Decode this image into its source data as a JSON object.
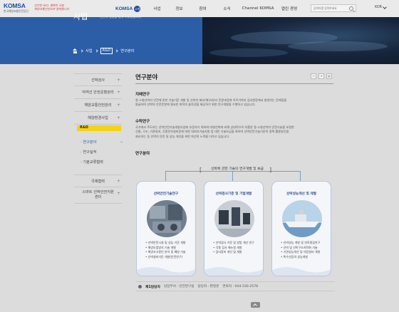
{
  "header": {
    "logo_text": "KOMSA",
    "logo_sub": "한국해양교통안전공단",
    "slogan_line1": "안전한 바다, 행복한 국민",
    "slogan_line2": "해양교통안전으로 함께합니다",
    "home_label": "KOMSA",
    "home_badge": "소개",
    "menu": [
      "사업",
      "정보",
      "참여",
      "소식",
      "Channel KOMSA",
      "열린 경영"
    ],
    "search_placeholder": "검색어를 입력하세요",
    "lang": "KOR"
  },
  "banner": {
    "title": "사업",
    "desc_line1": "세상에서 가장 안전한 바닷길,",
    "desc_line2": "안전의 행동을 멈춰 이루겠습니다",
    "breadcrumb": [
      "사업",
      "R&D",
      "연구분야"
    ]
  },
  "sidebar": {
    "items_top": [
      "선박검사",
      "여객선 안전운항관리",
      "해양교통안전관리",
      "해양환경사업"
    ],
    "selected_tag": "R&D",
    "sub_items": [
      "연구분야",
      "연구실적",
      "기술교류협력"
    ],
    "items_bottom": [
      "국제협력",
      "스마트 선박안전지원센터"
    ]
  },
  "content": {
    "page_title": "연구분야",
    "tool_icons": [
      "share-icon",
      "link-icon",
      "print-icon"
    ],
    "section1_heading": "지배연구",
    "section1_text_line1": "중·소형선박의 안전에 관한 기술기준 개발 및 선박의 제조(해)서부터 운항과정에 이르기까지 검사현장에서 발생하는 문제점을",
    "section1_text_line2": "발굴하여 선박의 안전운항에 필요한 최적의 솔루션을 제공하기 위한 연구개발을 수행하고 있습니다.",
    "section2_heading": "수탁연구",
    "section2_text_line1": "국가에서 주도하는 선박안전기술개발사업에 부응하기 위하여 대형선박에 비해 상대적으로 미흡한 중·소형선박의 안전기술을 포함한",
    "section2_text_line2": "선형, 구조, 기관설비, 각종전자설비등에 대한 대외부기술지원 및 대민 기술보급을 위하여 선박안전기술기준의 정책 활용방안을",
    "section2_text_line3": "제시하는 등 선박의 안전 및 성능 개선을 위한 최선의 노력을 다하고 있습니다.",
    "section3_heading": "연구분야"
  },
  "diagram": {
    "title": "선박에 관한 기술의 연구개발 및 보급",
    "cards": [
      {
        "title": "선박안전기술연구",
        "items": [
          "선박안전시설 및 성능 기준 개발",
          "해양오염방지 기술 개발",
          "해양사고원인 분석 및 예방 기술",
          "선박설비기준 개발(안전연구)"
        ]
      },
      {
        "title": "선박검사기준 및 기법개발",
        "items": [
          "선박검사 기준 및 방법 개선 연구",
          "각종 검사 매뉴얼 개발",
          "검사장비 개선 및 개발"
        ]
      },
      {
        "title": "선박성능개선 및 개발",
        "items": [
          "선박성능 개발 및 연료절감연구",
          "선박 및 선박구조처작화 기술",
          "기관성능개선 및 의장설비 개발",
          "특수선등의 성능개발"
        ]
      }
    ]
  },
  "footer": {
    "label": "제1담당자",
    "dept": "담당부서 : 안전연구실",
    "person": "담당자 : 편정훈",
    "phone": "연락처 : 044-330-2578"
  },
  "colors": {
    "brand_blue": "#1c4e9c",
    "banner_blue": "#2b5ea7",
    "highlight_yellow": "#f5d214"
  }
}
